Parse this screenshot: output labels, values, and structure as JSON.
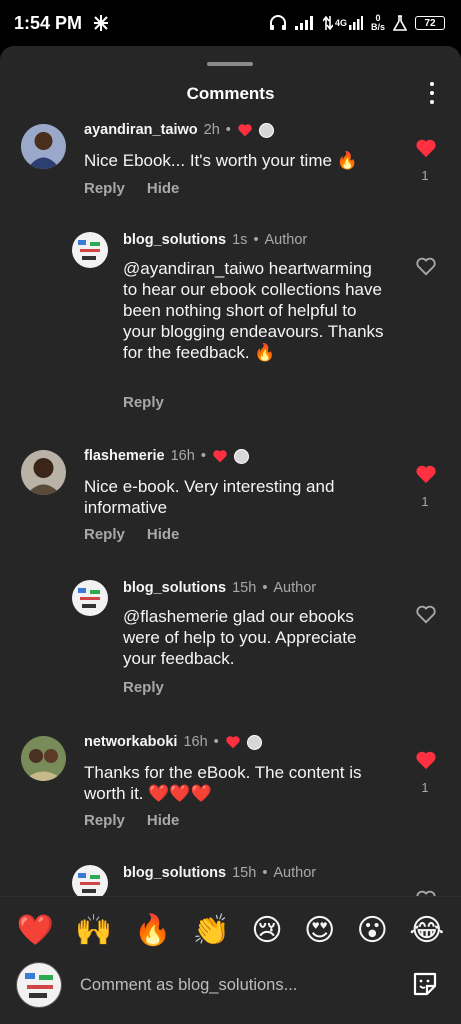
{
  "status_bar": {
    "time": "1:54 PM",
    "network_speed_value": "0",
    "network_speed_unit": "B/s",
    "network_type": "4G",
    "battery": "72"
  },
  "sheet": {
    "title": "Comments"
  },
  "comments": [
    {
      "username": "ayandiran_taiwo",
      "time": "2h",
      "text": "Nice Ebook... It's worth your time 🔥",
      "reply_label": "Reply",
      "hide_label": "Hide",
      "likes": "1",
      "liked": true
    },
    {
      "username": "blog_solutions",
      "time": "1s",
      "author_label": "Author",
      "text": "@ayandiran_taiwo heartwarming to hear our ebook collections have been nothing short of helpful to your blogging endeavours. Thanks for the feedback. 🔥",
      "reply_label": "Reply",
      "liked": false
    },
    {
      "username": "flashemerie",
      "time": "16h",
      "text": "Nice e-book. Very interesting and informative",
      "reply_label": "Reply",
      "hide_label": "Hide",
      "likes": "1",
      "liked": true
    },
    {
      "username": "blog_solutions",
      "time": "15h",
      "author_label": "Author",
      "text": "@flashemerie glad our ebooks were of help to you. Appreciate your feedback.",
      "reply_label": "Reply",
      "liked": false
    },
    {
      "username": "networkaboki",
      "time": "16h",
      "text": "Thanks for the eBook. The content is worth it. ❤️❤️❤️",
      "reply_label": "Reply",
      "hide_label": "Hide",
      "likes": "1",
      "liked": true
    },
    {
      "username": "blog_solutions",
      "time": "15h",
      "author_label": "Author",
      "liked": false
    }
  ],
  "emoji_bar": [
    "❤️",
    "🙌",
    "🔥",
    "👏",
    "😢",
    "😍",
    "😮",
    "😂"
  ],
  "input": {
    "placeholder": "Comment as blog_solutions..."
  },
  "colors": {
    "sheet_background": "#262626",
    "like_red": "#ff3040",
    "muted_text": "#a8a8a8"
  }
}
